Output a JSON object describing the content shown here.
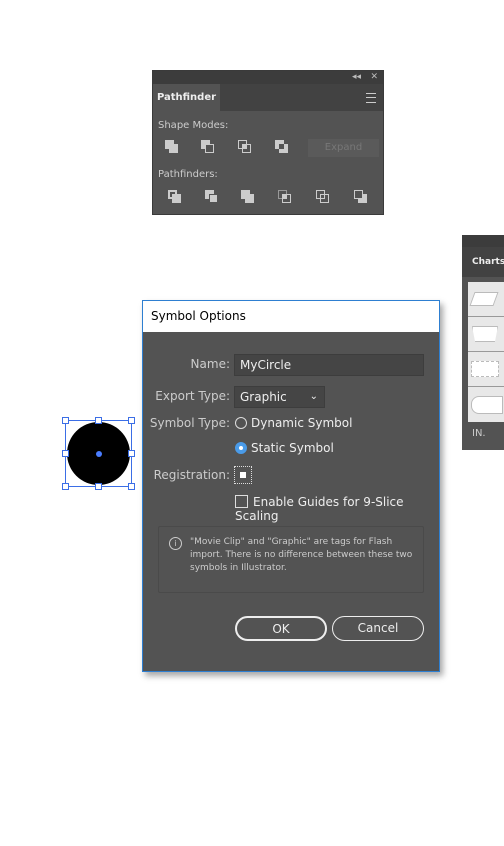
{
  "pathfinder": {
    "tab": "Pathfinder",
    "collapse_icon": "double-chevron-left",
    "close_icon": "close",
    "shape_modes_label": "Shape Modes:",
    "pathfinders_label": "Pathfinders:",
    "expand_label": "Expand",
    "shape_modes": [
      "unite",
      "minus-front",
      "intersect",
      "exclude"
    ],
    "pathfinder_ops": [
      "divide",
      "trim",
      "merge",
      "crop",
      "outline",
      "minus-back"
    ]
  },
  "charts_panel": {
    "tab": "Charts"
  },
  "dialog": {
    "title": "Symbol Options",
    "name_label": "Name:",
    "name_value": "MyCircle",
    "export_label": "Export Type:",
    "export_value": "Graphic",
    "symbol_type_label": "Symbol Type:",
    "dynamic_label": "Dynamic Symbol",
    "static_label": "Static Symbol",
    "symbol_type_selected": "Static Symbol",
    "registration_label": "Registration:",
    "guides_label": "Enable Guides for 9-Slice Scaling",
    "guides_checked": false,
    "info_text": "\"Movie Clip\" and \"Graphic\" are tags for Flash import. There is no difference between these two symbols in Illustrator.",
    "ok_label": "OK",
    "cancel_label": "Cancel",
    "accent": "#4a9be8"
  }
}
